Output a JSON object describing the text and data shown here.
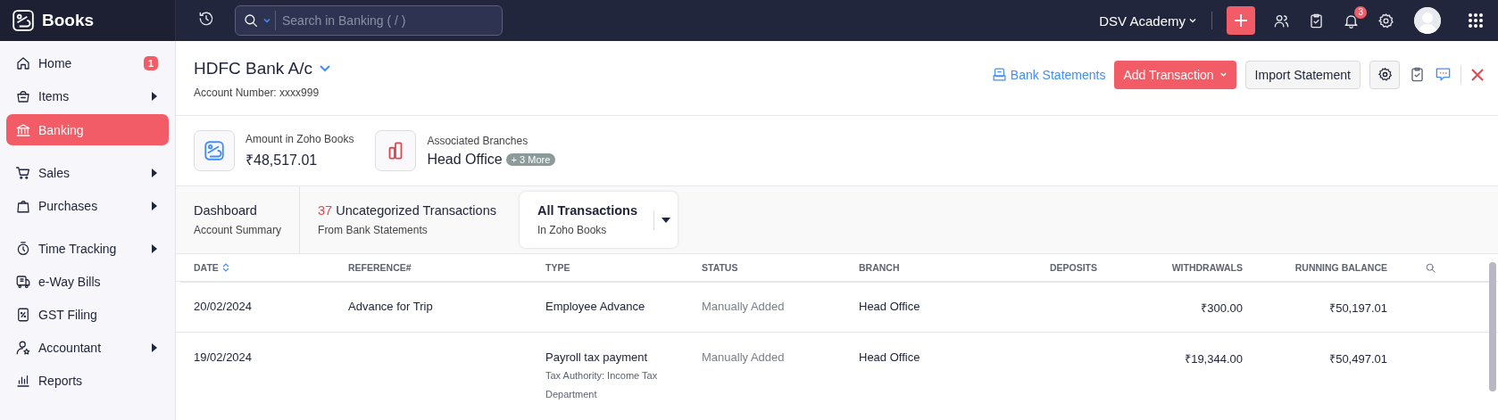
{
  "topbar": {
    "app_name": "Books",
    "search": {
      "placeholder": "Search in Banking ( / )"
    },
    "organization": "DSV Academy",
    "notification_count": "3"
  },
  "sidebar": {
    "sections": [
      [
        {
          "label": "Home",
          "badge": "1",
          "expandable": false,
          "selected": false
        },
        {
          "label": "Items",
          "expandable": true,
          "selected": false
        },
        {
          "label": "Banking",
          "expandable": false,
          "selected": true
        }
      ],
      [
        {
          "label": "Sales",
          "expandable": true,
          "selected": false
        },
        {
          "label": "Purchases",
          "expandable": true,
          "selected": false
        }
      ],
      [
        {
          "label": "Time Tracking",
          "expandable": true,
          "selected": false
        },
        {
          "label": "e-Way Bills",
          "expandable": false,
          "selected": false
        },
        {
          "label": "GST Filing",
          "expandable": false,
          "selected": false
        },
        {
          "label": "Accountant",
          "expandable": true,
          "selected": false
        },
        {
          "label": "Reports",
          "expandable": false,
          "selected": false
        }
      ]
    ]
  },
  "header": {
    "title": "HDFC Bank A/c",
    "account_number": "Account Number: xxxx999",
    "actions": {
      "bank_statements": "Bank Statements",
      "add_transaction": "Add Transaction",
      "import_statement": "Import Statement"
    }
  },
  "summary": [
    {
      "label": "Amount in Zoho Books",
      "value": "₹48,517.01"
    },
    {
      "label": "Associated Branches",
      "value": "Head Office",
      "more": "+ 3 More"
    }
  ],
  "views": [
    {
      "title": "Dashboard",
      "subtitle": "Account Summary",
      "selected": false
    },
    {
      "count": "37",
      "title": "Uncategorized Transactions",
      "subtitle": "From Bank Statements",
      "selected": false
    },
    {
      "title": "All Transactions",
      "subtitle": "In Zoho Books",
      "selected": true,
      "dropdown": true
    }
  ],
  "table": {
    "columns": [
      {
        "label": "DATE",
        "sortable": true,
        "numeric": false
      },
      {
        "label": "REFERENCE#",
        "numeric": false
      },
      {
        "label": "TYPE",
        "numeric": false
      },
      {
        "label": "STATUS",
        "numeric": false
      },
      {
        "label": "BRANCH",
        "numeric": false
      },
      {
        "label": "DEPOSITS",
        "numeric": true
      },
      {
        "label": "WITHDRAWALS",
        "numeric": true
      },
      {
        "label": "RUNNING BALANCE",
        "numeric": true
      }
    ],
    "rows": [
      {
        "date": "20/02/2024",
        "reference": "Advance for Trip",
        "type": "Employee Advance",
        "status": "Manually Added",
        "branch": "Head Office",
        "withdrawals": "₹300.00",
        "running_balance": "₹50,197.01"
      },
      {
        "date": "19/02/2024",
        "type": "Payroll tax payment",
        "type_detail": "Tax Authority: Income Tax Department",
        "status": "Manually Added",
        "branch": "Head Office",
        "withdrawals": "₹19,344.00",
        "running_balance": "₹50,497.01"
      }
    ]
  }
}
